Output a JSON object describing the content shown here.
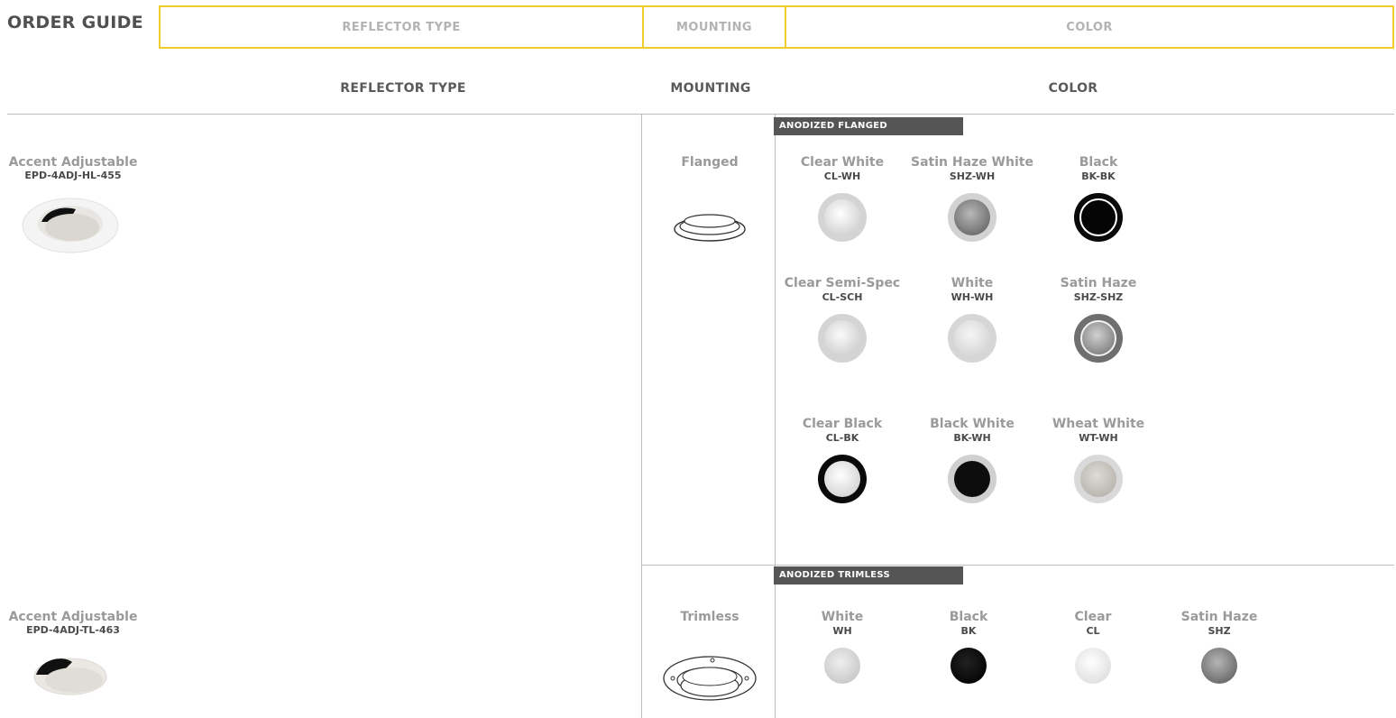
{
  "header": {
    "title": "ORDER GUIDE",
    "tabs": {
      "reflector": "REFLECTOR TYPE",
      "mounting": "MOUNTING",
      "color": "COLOR"
    },
    "accent_color": "#f2cc2f"
  },
  "columns": {
    "reflector": "REFLECTOR TYPE",
    "mounting": "MOUNTING",
    "color": "COLOR"
  },
  "rows": [
    {
      "product_name": "Accent Adjustable",
      "product_code": "EPD-4ADJ-HL-455",
      "mounting": "Flanged",
      "section": "ANODIZED FLANGED",
      "swatches": [
        {
          "name": "Clear White",
          "code": "CL-WH",
          "ring": "#d4d4d4",
          "center": "#ededed"
        },
        {
          "name": "Satin Haze White",
          "code": "SHZ-WH",
          "ring": "#d0d0d0",
          "center": "#8a8a8a"
        },
        {
          "name": "Black",
          "code": "BK-BK",
          "ring": "#0a0a0a",
          "center": "#0a0a0a"
        },
        {
          "name": "Clear Semi-Spec",
          "code": "CL-SCH",
          "ring": "#d4d4d4",
          "center": "#e8e8e8"
        },
        {
          "name": "White",
          "code": "WH-WH",
          "ring": "#d6d6d6",
          "center": "#e6e6e6"
        },
        {
          "name": "Satin Haze",
          "code": "SHZ-SHZ",
          "ring": "#6f6f6f",
          "center": "#9a9a9a"
        },
        {
          "name": "Clear Black",
          "code": "CL-BK",
          "ring": "#0a0a0a",
          "center": "#ededed"
        },
        {
          "name": "Black White",
          "code": "BK-WH",
          "ring": "#d0d0d0",
          "center": "#0d0d0d"
        },
        {
          "name": "Wheat White",
          "code": "WT-WH",
          "ring": "#d9d9d9",
          "center": "#bdbab5"
        }
      ]
    },
    {
      "product_name": "Accent Adjustable",
      "product_code": "EPD-4ADJ-TL-463",
      "mounting": "Trimless",
      "section": "ANODIZED TRIMLESS",
      "swatches": [
        {
          "name": "White",
          "code": "WH",
          "fill": "#d8d8d8"
        },
        {
          "name": "Black",
          "code": "BK",
          "fill": "#0a0a0a"
        },
        {
          "name": "Clear",
          "code": "CL",
          "fill": "#f0f0f0"
        },
        {
          "name": "Satin Haze",
          "code": "SHZ",
          "fill": "#8a8a8a"
        }
      ]
    }
  ]
}
